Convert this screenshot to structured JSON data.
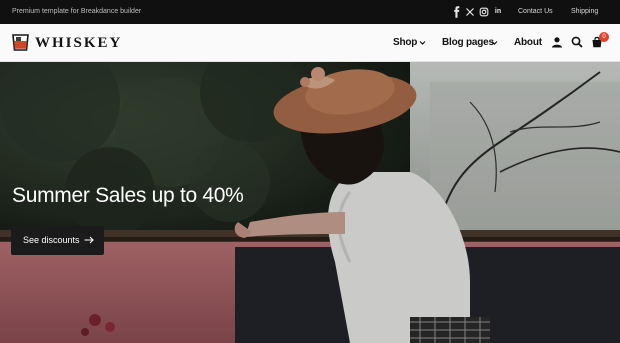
{
  "topbar": {
    "tagline": "Premium template for Breakdance builder",
    "social_icons": [
      "facebook-icon",
      "x-icon",
      "instagram-icon",
      "linkedin-icon"
    ],
    "links": [
      "Contact Us",
      "Shipping"
    ]
  },
  "header": {
    "logo_text": "WHISKEY",
    "nav": [
      {
        "label": "Shop",
        "has_dropdown": true
      },
      {
        "label": "Blog pages",
        "has_dropdown": true
      },
      {
        "label": "About",
        "has_dropdown": false
      }
    ],
    "icons": [
      "user-icon",
      "search-icon",
      "cart-icon"
    ],
    "cart_count": "0"
  },
  "hero": {
    "title": "Summer Sales up to 40%",
    "cta_label": "See discounts"
  },
  "colors": {
    "topbar_bg": "#101010",
    "header_bg": "#fafafa",
    "badge": "#e0432d",
    "button_bg": "#1b1b1b"
  }
}
